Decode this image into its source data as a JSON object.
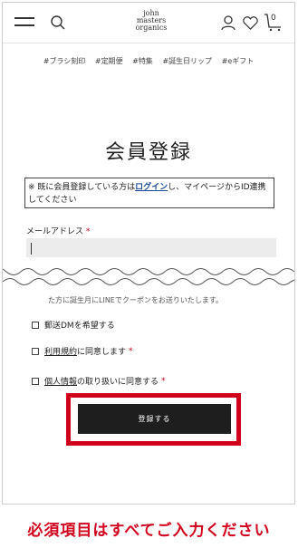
{
  "header": {
    "logo_lines": [
      "john",
      "masters",
      "organics"
    ],
    "cart_count": "0"
  },
  "tags": [
    "#ブラシ刻印",
    "#定期便",
    "#特集",
    "#誕生日リップ",
    "#eギフト"
  ],
  "title": "会員登録",
  "notice": {
    "prefix": "※ 既に会員登録している方は",
    "link": "ログイン",
    "suffix": "し、マイページからID連携してください"
  },
  "email": {
    "label": "メールアドレス",
    "required_mark": "*",
    "value": ""
  },
  "partial_text": "た方に誕生月にLINEでクーポンをお送りいたします。",
  "checkboxes": [
    {
      "pre": "",
      "link": "",
      "post": "郵送DMを希望する",
      "required": ""
    },
    {
      "pre": "",
      "link": "利用規約",
      "post": "に同意します",
      "required": "*"
    },
    {
      "pre": "",
      "link": "個人情報",
      "post": "の取り扱いに同意する",
      "required": "*"
    }
  ],
  "submit_label": "登録する",
  "footer_note": "必須項目はすべてご入力ください",
  "colors": {
    "accent_red": "#d0001c",
    "button_dark": "#1e1e1e",
    "link_blue": "#1a4a9a"
  }
}
